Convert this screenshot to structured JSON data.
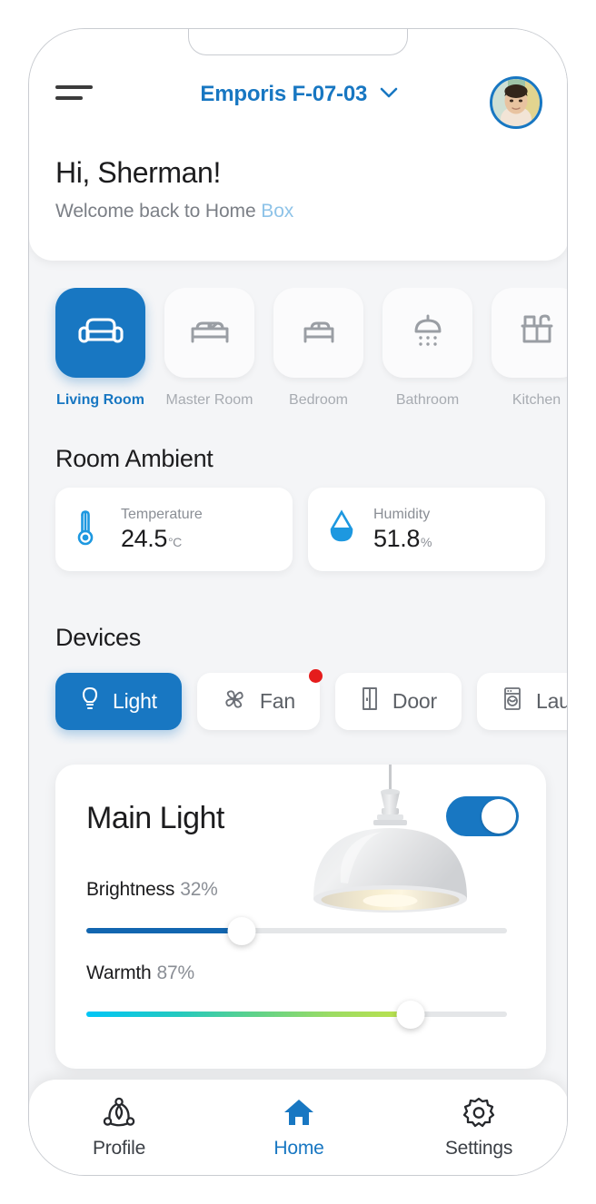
{
  "app": {
    "accent_color": "#1877c2",
    "brand_light_color": "#8ec3e8",
    "alert_color": "#e51c1c",
    "background_color": "#f4f5f7"
  },
  "header": {
    "menu_icon": "hamburger-menu-icon",
    "home_name": "Emporis F-07-03",
    "home_dropdown_icon": "chevron-down-icon",
    "avatar_icon": "user-avatar-photo",
    "greeting": "Hi, Sherman!",
    "subtitle_prefix": "Welcome back to Home",
    "subtitle_brand": "Box"
  },
  "rooms": {
    "items": [
      {
        "label": "Living Room",
        "icon": "sofa-icon",
        "active": true
      },
      {
        "label": "Master Room",
        "icon": "double-bed-icon",
        "active": false
      },
      {
        "label": "Bedroom",
        "icon": "single-bed-icon",
        "active": false
      },
      {
        "label": "Bathroom",
        "icon": "shower-icon",
        "active": false
      },
      {
        "label": "Kitchen",
        "icon": "kitchen-sink-icon",
        "active": false
      }
    ]
  },
  "ambient": {
    "title": "Room Ambient",
    "cards": [
      {
        "name": "Temperature",
        "icon": "thermometer-icon",
        "value": "24.5",
        "unit": "°C"
      },
      {
        "name": "Humidity",
        "icon": "water-drop-icon",
        "value": "51.8",
        "unit": "%"
      }
    ]
  },
  "devices": {
    "title": "Devices",
    "chips": [
      {
        "label": "Light",
        "icon": "light-bulb-icon",
        "active": true,
        "badge": false
      },
      {
        "label": "Fan",
        "icon": "fan-icon",
        "active": false,
        "badge": true
      },
      {
        "label": "Door",
        "icon": "door-icon",
        "active": false,
        "badge": false
      },
      {
        "label": "Laundry",
        "icon": "washing-machine-icon",
        "active": false,
        "badge": false
      }
    ]
  },
  "light_card": {
    "title": "Main Light",
    "power_on": true,
    "power_toggle_icon": "toggle-switch-on-icon",
    "illustration": "pendant-lamp-image",
    "brightness": {
      "caption": "Brightness",
      "value_label": "32%",
      "value": 32,
      "thumb_position_pct": 37
    },
    "warmth": {
      "caption": "Warmth",
      "value_label": "87%",
      "value": 87,
      "thumb_position_pct": 77
    }
  },
  "bottom_nav": {
    "items": [
      {
        "label": "Profile",
        "icon": "people-group-icon",
        "active": false
      },
      {
        "label": "Home",
        "icon": "home-house-icon",
        "active": true
      },
      {
        "label": "Settings",
        "icon": "gear-icon",
        "active": false
      }
    ]
  }
}
